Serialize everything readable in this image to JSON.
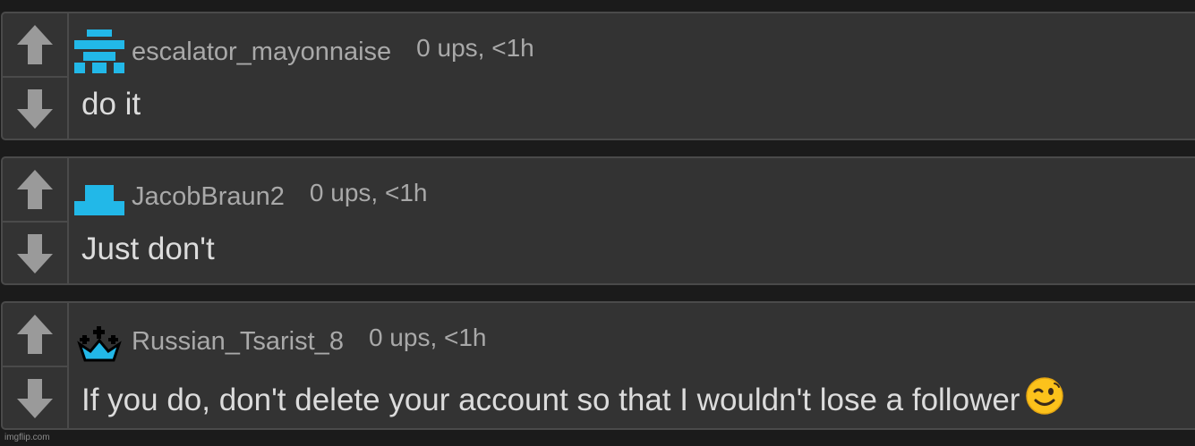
{
  "comments": [
    {
      "username": "escalator_mayonnaise",
      "meta": "0 ups, <1h",
      "text": "do it",
      "avatar_icon": "pixel-creature-icon",
      "avatar_color": "#22b8e8"
    },
    {
      "username": "JacobBraun2",
      "meta": "0 ups, <1h",
      "text": "Just don't",
      "avatar_icon": "pixel-hat-icon",
      "avatar_color": "#22b8e8"
    },
    {
      "username": "Russian_Tsarist_8",
      "meta": "0 ups, <1h",
      "text": "If you do, don't delete your account so that I wouldn't lose a follower",
      "avatar_icon": "crown-icon",
      "avatar_color": "#22b8e8",
      "trailing_emoji": "winking-face-icon"
    }
  ],
  "watermark": "imgflip.com",
  "colors": {
    "background": "#1b1b1b",
    "card": "#333333",
    "border": "#4a4a4a",
    "arrow": "#9a9a9a",
    "meta_text": "#a9a9a9",
    "body_text": "#dcdcdc"
  }
}
